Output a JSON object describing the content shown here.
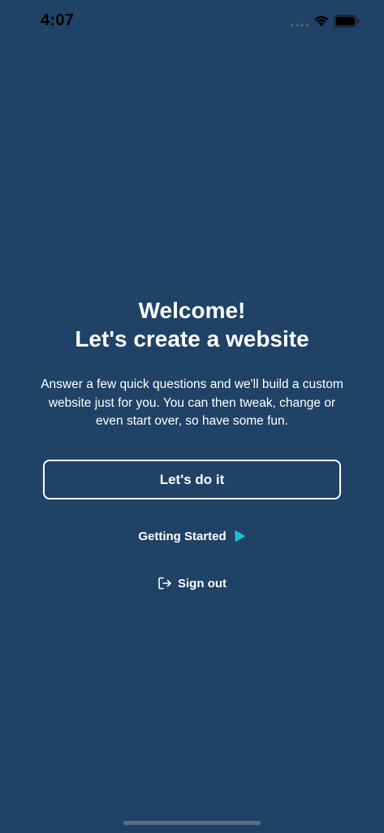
{
  "status_bar": {
    "time": "4:07"
  },
  "welcome": {
    "title_line1": "Welcome!",
    "title_line2": "Let's create a website",
    "intro_text": "Answer a few quick questions and we'll build a custom website just for you. You can then tweak, change or even start over, so have some fun."
  },
  "actions": {
    "primary_label": "Let's do it",
    "getting_started_label": "Getting Started",
    "sign_out_label": "Sign out"
  },
  "icons": {
    "status": [
      "signal-dots-icon",
      "wifi-icon",
      "battery-icon"
    ],
    "getting_started": "play-icon",
    "sign_out": "sign-out-icon"
  },
  "colors": {
    "background": "#1f4266",
    "text": "#ffffff",
    "accent_play": "#19c3cf"
  }
}
